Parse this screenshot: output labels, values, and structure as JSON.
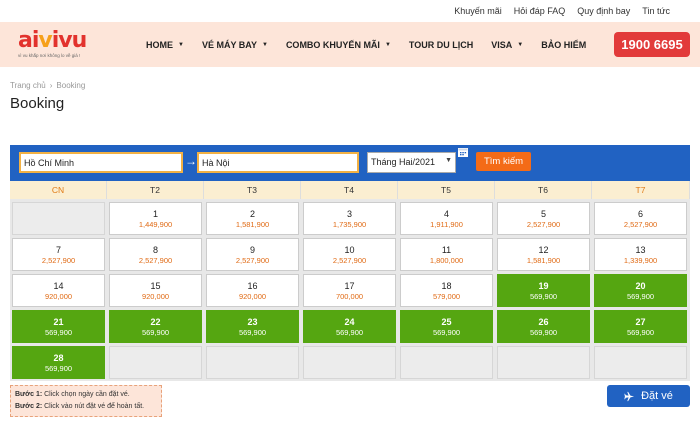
{
  "topbar": {
    "links": [
      "Khuyến mãi",
      "Hỏi đáp FAQ",
      "Quy định bay",
      "Tin tức"
    ]
  },
  "header": {
    "logo_text_a": "ai",
    "logo_text_b": "v",
    "logo_text_c": "i",
    "logo_text_d": "vu",
    "logo_tagline": "vì vu khắp nơi không lo về giá !",
    "menu": [
      "HOME",
      "VÉ MÁY BAY",
      "COMBO KHUYẾN MÃI",
      "TOUR DU LỊCH",
      "VISA",
      "BẢO HIỂM"
    ],
    "hotline": "1900 6695"
  },
  "breadcrumb": {
    "home": "Trang chủ",
    "separator": "›",
    "current": "Booking"
  },
  "page_title": "Booking",
  "search": {
    "from": "Hồ Chí Minh",
    "arrow": "→",
    "to": "Hà Nội",
    "month": "Tháng Hai/2021",
    "button": "Tìm kiếm"
  },
  "calendar": {
    "days": [
      "CN",
      "T2",
      "T3",
      "T4",
      "T5",
      "T6",
      "T7"
    ],
    "weeks": [
      [
        null,
        {
          "d": "1",
          "p": "1,449,900"
        },
        {
          "d": "2",
          "p": "1,581,900"
        },
        {
          "d": "3",
          "p": "1,735,900"
        },
        {
          "d": "4",
          "p": "1,911,900"
        },
        {
          "d": "5",
          "p": "2,527,900"
        },
        {
          "d": "6",
          "p": "2,527,900"
        }
      ],
      [
        {
          "d": "7",
          "p": "2,527,900"
        },
        {
          "d": "8",
          "p": "2,527,900"
        },
        {
          "d": "9",
          "p": "2,527,900"
        },
        {
          "d": "10",
          "p": "2,527,900"
        },
        {
          "d": "11",
          "p": "1,800,000"
        },
        {
          "d": "12",
          "p": "1,581,900"
        },
        {
          "d": "13",
          "p": "1,339,900"
        }
      ],
      [
        {
          "d": "14",
          "p": "920,000"
        },
        {
          "d": "15",
          "p": "920,000"
        },
        {
          "d": "16",
          "p": "920,000"
        },
        {
          "d": "17",
          "p": "700,000"
        },
        {
          "d": "18",
          "p": "579,000"
        },
        {
          "d": "19",
          "p": "569,900",
          "g": true
        },
        {
          "d": "20",
          "p": "569,900",
          "g": true
        }
      ],
      [
        {
          "d": "21",
          "p": "569,900",
          "g": true
        },
        {
          "d": "22",
          "p": "569,900",
          "g": true
        },
        {
          "d": "23",
          "p": "569,900",
          "g": true
        },
        {
          "d": "24",
          "p": "569,900",
          "g": true
        },
        {
          "d": "25",
          "p": "569,900",
          "g": true
        },
        {
          "d": "26",
          "p": "569,900",
          "g": true
        },
        {
          "d": "27",
          "p": "569,900",
          "g": true
        }
      ],
      [
        {
          "d": "28",
          "p": "569,900",
          "g": true
        },
        null,
        null,
        null,
        null,
        null,
        null
      ]
    ]
  },
  "steps": {
    "step1_label": "Bước 1:",
    "step1_text": " Click chọn ngày cần đặt vé.",
    "step2_label": "Bước 2:",
    "step2_text": " Click vào nút đặt vé để hoàn tất."
  },
  "book_button": "Đặt vé",
  "colors": {
    "brand_blue": "#2162c2",
    "green": "#55a611",
    "orange": "#f46b17",
    "red": "#e23a3a"
  }
}
